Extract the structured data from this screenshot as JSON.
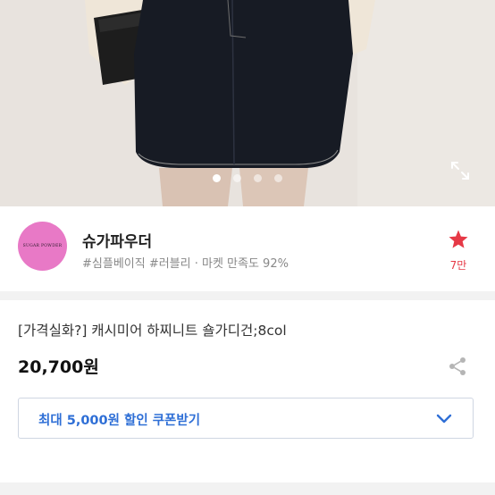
{
  "gallery": {
    "slide_count": 4,
    "active_index": 0
  },
  "shop": {
    "logo_text": "SUGAR POWDER",
    "name": "슈가파우더",
    "tags": "#심플베이직 #러블리 · 마켓 만족도 92%",
    "favorite_count": "7만",
    "favorite_color": "#e63946"
  },
  "product": {
    "title": "[가격실화?] 캐시미어 하찌니트 숄가디건;8col",
    "price": "20,700원"
  },
  "coupon": {
    "label": "최대 5,000원 할인 쿠폰받기",
    "accent_color": "#2f6fd6"
  },
  "icons": {
    "expand": "expand-icon",
    "star": "star-icon",
    "share": "share-icon",
    "chevron": "chevron-down-icon"
  }
}
